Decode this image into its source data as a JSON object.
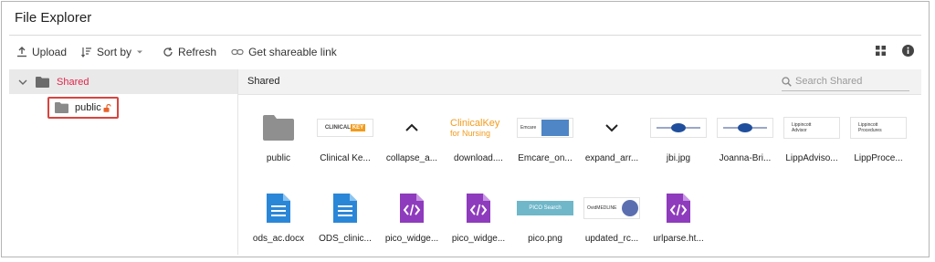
{
  "title": "File Explorer",
  "toolbar": {
    "upload": "Upload",
    "sort_by": "Sort by",
    "refresh": "Refresh",
    "share_link": "Get shareable link"
  },
  "tree": {
    "root": "Shared",
    "child": "public"
  },
  "breadcrumb": "Shared",
  "search": {
    "placeholder": "Search Shared"
  },
  "files": [
    {
      "name": "public",
      "kind": "folder"
    },
    {
      "name": "Clinical Ke...",
      "kind": "image",
      "thumb_text": "CLINICALKEY"
    },
    {
      "name": "collapse_a...",
      "kind": "image-arrow-up"
    },
    {
      "name": "download....",
      "kind": "image",
      "thumb_text": "ClinicalKey",
      "thumb_sub": "for Nursing"
    },
    {
      "name": "Emcare_on...",
      "kind": "image",
      "thumb_text": "Emcare"
    },
    {
      "name": "expand_arr...",
      "kind": "image-arrow-down"
    },
    {
      "name": "jbi.jpg",
      "kind": "image-logo"
    },
    {
      "name": "Joanna-Bri...",
      "kind": "image-logo"
    },
    {
      "name": "LippAdviso...",
      "kind": "image-lipp",
      "thumb_text": "Lippincott",
      "thumb_sub": "Advisor"
    },
    {
      "name": "LippProce...",
      "kind": "image-lipp",
      "thumb_text": "Lippincott",
      "thumb_sub": "Procedures"
    },
    {
      "name": "ods_ac.docx",
      "kind": "doc"
    },
    {
      "name": "ODS_clinic...",
      "kind": "doc"
    },
    {
      "name": "pico_widge...",
      "kind": "code"
    },
    {
      "name": "pico_widge...",
      "kind": "code"
    },
    {
      "name": "pico.png",
      "kind": "image",
      "thumb_text": "PICO Search"
    },
    {
      "name": "updated_rc...",
      "kind": "image",
      "thumb_text": "OvidMEDLINE"
    },
    {
      "name": "urlparse.ht...",
      "kind": "code"
    }
  ],
  "colors": {
    "accent_red": "#e0254a",
    "highlight_border": "#d9443f",
    "folder_grey": "#8f8f8f",
    "doc_blue": "#2a87d8",
    "code_purple": "#8e3bbd"
  }
}
